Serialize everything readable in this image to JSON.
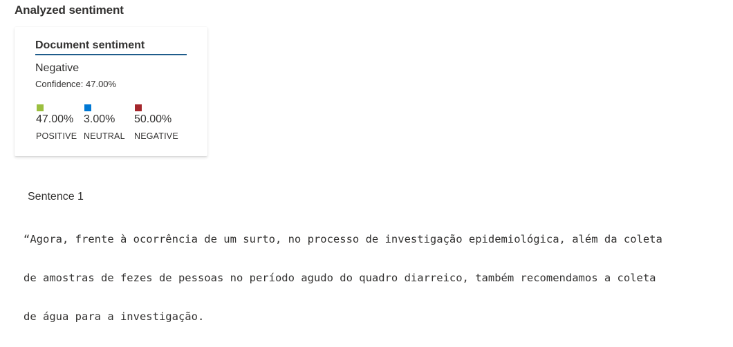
{
  "page": {
    "title": "Analyzed sentiment"
  },
  "document_sentiment": {
    "title": "Document sentiment",
    "label": "Negative",
    "confidence": "Confidence: 47.00%",
    "scores": [
      {
        "value": "47.00%",
        "caption": "POSITIVE",
        "color": "#9bbf3f"
      },
      {
        "value": "3.00%",
        "caption": "NEUTRAL",
        "color": "#0078d4"
      },
      {
        "value": "50.00%",
        "caption": "NEGATIVE",
        "color": "#a4262c"
      }
    ]
  },
  "sentence": {
    "label": "Sentence 1",
    "lines": [
      "“Agora, frente à ocorrência de um surto, no processo de investigação epidemiológica, além da coleta",
      "de amostras de fezes de pessoas no período agudo do quadro diarreico, também recomendamos a coleta",
      "de água para a investigação."
    ]
  }
}
